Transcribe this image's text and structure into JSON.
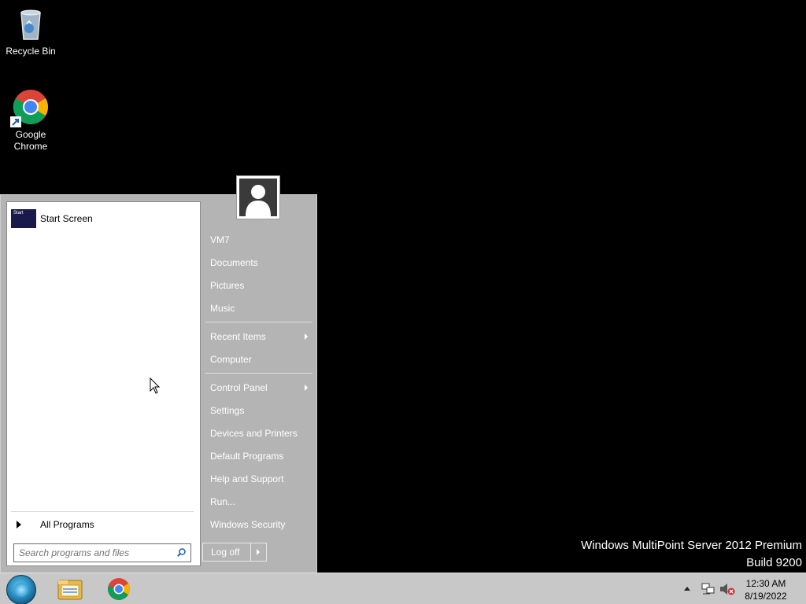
{
  "desktop": {
    "icons": [
      {
        "label": "Recycle Bin"
      },
      {
        "label": "Google Chrome"
      }
    ]
  },
  "start_menu": {
    "pinned": [
      {
        "label": "Start Screen",
        "tile_text": "Start"
      }
    ],
    "all_programs_label": "All Programs",
    "search": {
      "placeholder": "Search programs and files",
      "value": ""
    },
    "user": {
      "name": "VM7"
    },
    "right_items": [
      {
        "label": "VM7"
      },
      {
        "label": "Documents"
      },
      {
        "label": "Pictures"
      },
      {
        "label": "Music"
      },
      {
        "label": "Recent Items",
        "submenu": true
      },
      {
        "label": "Computer"
      },
      {
        "label": "Control Panel",
        "submenu": true
      },
      {
        "label": "Settings"
      },
      {
        "label": "Devices and Printers"
      },
      {
        "label": "Default Programs"
      },
      {
        "label": "Help and Support"
      },
      {
        "label": "Run..."
      },
      {
        "label": "Windows Security"
      }
    ],
    "logoff_label": "Log off"
  },
  "watermark": {
    "line1": "Windows MultiPoint Server 2012 Premium",
    "line2": "Build 9200"
  },
  "taskbar": {
    "pinned": [
      "file-explorer-icon",
      "chrome-icon"
    ],
    "tray_icons": [
      "show-hidden-icons",
      "network-icon",
      "volume-muted-icon"
    ],
    "clock": {
      "time": "12:30 AM",
      "date": "8/19/2022"
    }
  },
  "colors": {
    "desktop_bg": "#000000",
    "start_menu_bg": "#b4b4b4",
    "taskbar_bg": "#c8c8c8"
  }
}
